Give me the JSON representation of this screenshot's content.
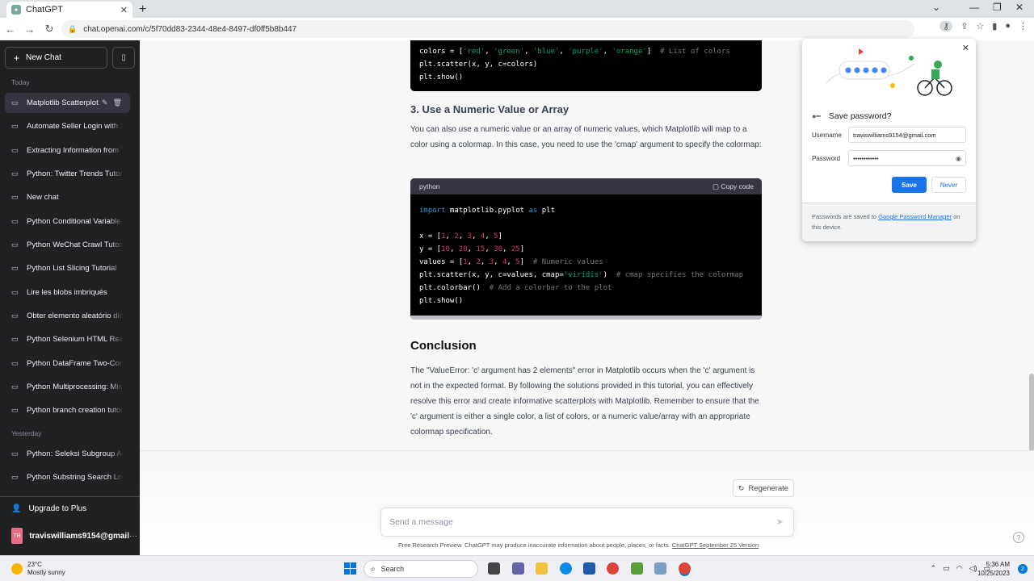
{
  "browser": {
    "tab_title": "ChatGPT",
    "url": "chat.openai.com/c/5f70dd83-2344-48e4-8497-df0ff5b8b447"
  },
  "sidebar": {
    "new_chat_label": "New Chat",
    "today_label": "Today",
    "yesterday_label": "Yesterday",
    "today_items": [
      "Matplotlib Scatterplot",
      "Automate Seller Login with X",
      "Extracting Information from T",
      "Python: Twitter Trends Tutorial",
      "New chat",
      "Python Conditional Variable",
      "Python WeChat Crawl Tutorial",
      "Python List Slicing Tutorial",
      "Lire les blobs imbriqués",
      "Obter elemento aleatório dic",
      "Python Selenium HTML Read",
      "Python DataFrame Two-Cond",
      "Python Multiprocessing: Mis",
      "Python branch creation tutor"
    ],
    "yesterday_items": [
      "Python: Seleksi Subgroup Ac",
      "Python Substring Search Loo"
    ],
    "upgrade_label": "Upgrade to Plus",
    "user_initials": "TR",
    "user_name": "traviswilliams9154@gmail"
  },
  "content": {
    "code1_lines": {
      "l1": "colors = [",
      "l1_strs": [
        "'red'",
        "'green'",
        "'blue'",
        "'purple'",
        "'orange'"
      ],
      "l1_comment": "# List of colors",
      "l2": "plt.scatter(x, y, c=colors)",
      "l3": "plt.show()"
    },
    "section3_title": "3. Use a Numeric Value or Array",
    "section3_text": "You can also use a numeric value or an array of numeric values, which Matplotlib will map to a color using a colormap. In this case, you need to use the 'cmap' argument to specify the colormap:",
    "code2": {
      "lang": "python",
      "copy_label": "Copy code"
    },
    "conclusion_title": "Conclusion",
    "conclusion_text": "The \"ValueError: 'c' argument has 2 elements\" error in Matplotlib occurs when the 'c' argument is not in the expected format. By following the solutions provided in this tutorial, you can effectively resolve this error and create informative scatterplots with Matplotlib. Remember to ensure that the 'c' argument is either a single color, a list of colors, or a numeric value/array with an appropriate colormap specification.",
    "regenerate_label": "Regenerate",
    "message_placeholder": "Send a message",
    "footer_text": "Free Research Preview. ChatGPT may produce inaccurate information about people, places, or facts.",
    "footer_link": "ChatGPT September 25 Version"
  },
  "password_popup": {
    "title": "Save password?",
    "username_label": "Username",
    "username_value": "traviswilliams9154@gmail.com",
    "password_label": "Password",
    "password_value": "••••••••••••",
    "save_label": "Save",
    "never_label": "Never",
    "footer_pre": "Passwords are saved to",
    "footer_link": "Google Password Manager",
    "footer_post": "on this device."
  },
  "taskbar": {
    "temp": "23°C",
    "weather": "Mostly sunny",
    "search_label": "Search",
    "time": "5:36 AM",
    "date": "10/25/2023",
    "notif_count": "2"
  },
  "colors": {
    "sidebar_bg": "#202123",
    "accent_blue": "#1a73e8",
    "code_bg": "#000000"
  }
}
